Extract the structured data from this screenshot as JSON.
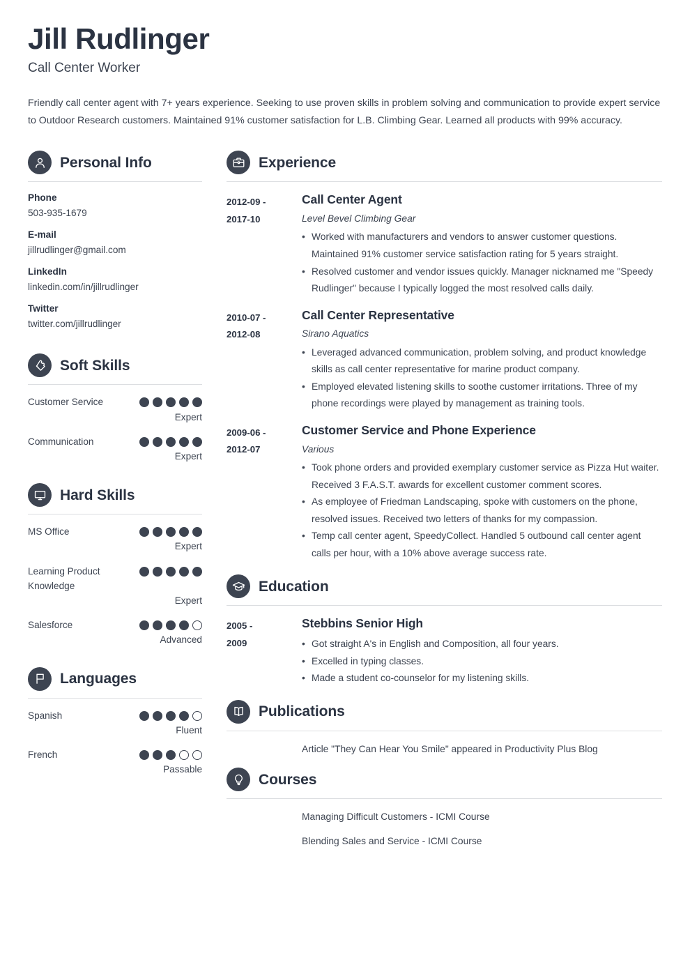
{
  "header": {
    "name": "Jill Rudlinger",
    "job_title": "Call Center Worker",
    "summary": "Friendly call center agent with 7+ years experience. Seeking to use proven skills in problem solving and communication to provide expert service to Outdoor Research customers. Maintained 91% customer satisfaction for L.B. Climbing Gear. Learned all products with 99% accuracy."
  },
  "colors": {
    "accent_dark": "#3d4451",
    "heading": "#2b3342",
    "body_text": "#3d4451",
    "rule": "#dcdee1",
    "background": "#ffffff"
  },
  "personal_info": {
    "title": "Personal Info",
    "icon": "person-icon",
    "items": [
      {
        "label": "Phone",
        "value": "503-935-1679"
      },
      {
        "label": "E-mail",
        "value": "jillrudlinger@gmail.com"
      },
      {
        "label": "LinkedIn",
        "value": "linkedin.com/in/jillrudlinger"
      },
      {
        "label": "Twitter",
        "value": "twitter.com/jillrudlinger"
      }
    ]
  },
  "soft_skills": {
    "title": "Soft Skills",
    "icon": "puzzle-piece-icon",
    "items": [
      {
        "name": "Customer Service",
        "filled": 5,
        "total": 5,
        "level": "Expert"
      },
      {
        "name": "Communication",
        "filled": 5,
        "total": 5,
        "level": "Expert"
      }
    ]
  },
  "hard_skills": {
    "title": "Hard Skills",
    "icon": "monitor-icon",
    "items": [
      {
        "name": "MS Office",
        "filled": 5,
        "total": 5,
        "level": "Expert"
      },
      {
        "name": "Learning Product Knowledge",
        "filled": 5,
        "total": 5,
        "level": "Expert"
      },
      {
        "name": "Salesforce",
        "filled": 4,
        "total": 5,
        "level": "Advanced"
      }
    ]
  },
  "languages": {
    "title": "Languages",
    "icon": "flag-icon",
    "items": [
      {
        "name": "Spanish",
        "filled": 4,
        "total": 5,
        "level": "Fluent"
      },
      {
        "name": "French",
        "filled": 3,
        "total": 5,
        "level": "Passable"
      }
    ]
  },
  "experience": {
    "title": "Experience",
    "icon": "briefcase-icon",
    "entries": [
      {
        "date_from": "2012-09 -",
        "date_to": "2017-10",
        "title": "Call Center Agent",
        "subtitle": "Level Bevel Climbing Gear",
        "bullets": [
          "Worked with manufacturers and vendors to answer customer questions. Maintained 91% customer service satisfaction rating for 5 years straight.",
          "Resolved customer and vendor issues quickly. Manager nicknamed me \"Speedy Rudlinger\" because I typically logged the most resolved calls daily."
        ]
      },
      {
        "date_from": "2010-07 -",
        "date_to": "2012-08",
        "title": "Call Center Representative",
        "subtitle": "Sirano Aquatics",
        "bullets": [
          "Leveraged advanced communication, problem solving, and product knowledge skills as call center representative for marine product company.",
          "Employed elevated listening skills to soothe customer irritations. Three of my phone recordings were played by management as training tools."
        ]
      },
      {
        "date_from": "2009-06 -",
        "date_to": "2012-07",
        "title": "Customer Service and Phone Experience",
        "subtitle": "Various",
        "bullets": [
          "Took phone orders and provided exemplary customer service as Pizza Hut waiter. Received 3 F.A.S.T. awards for excellent customer comment scores.",
          "As employee of Friedman Landscaping, spoke with customers on the phone, resolved issues. Received two letters of thanks for my compassion.",
          "Temp call center agent, SpeedyCollect. Handled 5 outbound call center agent calls per hour, with a 10% above average success rate."
        ]
      }
    ]
  },
  "education": {
    "title": "Education",
    "icon": "graduation-cap-icon",
    "entries": [
      {
        "date_from": "2005 -",
        "date_to": "2009",
        "title": "Stebbins Senior High",
        "bullets": [
          "Got straight A's in English and Composition, all four years.",
          "Excelled in typing classes.",
          "Made a student co-counselor for my listening skills."
        ]
      }
    ]
  },
  "publications": {
    "title": "Publications",
    "icon": "open-book-icon",
    "lines": [
      "Article \"They Can Hear You Smile\" appeared in Productivity Plus Blog"
    ]
  },
  "courses": {
    "title": "Courses",
    "icon": "lightbulb-icon",
    "lines": [
      "Managing Difficult Customers - ICMI Course",
      "Blending Sales and Service - ICMI Course"
    ]
  }
}
